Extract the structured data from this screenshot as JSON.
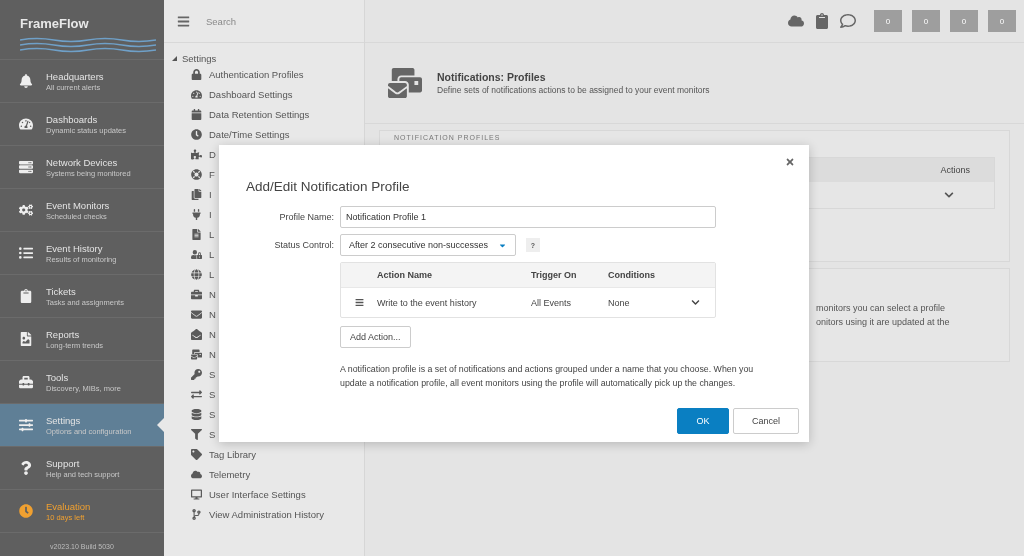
{
  "sidebar": {
    "brand": "FrameFlow",
    "nav": [
      {
        "title": "Headquarters",
        "subtitle": "All current alerts",
        "selected": false,
        "kind": "nav"
      },
      {
        "title": "Dashboards",
        "subtitle": "Dynamic status updates",
        "selected": false,
        "kind": "nav"
      },
      {
        "title": "Network Devices",
        "subtitle": "Systems being monitored",
        "selected": false,
        "kind": "nav"
      },
      {
        "title": "Event Monitors",
        "subtitle": "Scheduled checks",
        "selected": false,
        "kind": "nav"
      },
      {
        "title": "Event History",
        "subtitle": "Results of monitoring",
        "selected": false,
        "kind": "nav"
      },
      {
        "title": "Tickets",
        "subtitle": "Tasks and assignments",
        "selected": false,
        "kind": "nav"
      },
      {
        "title": "Reports",
        "subtitle": "Long-term trends",
        "selected": false,
        "kind": "nav"
      },
      {
        "title": "Tools",
        "subtitle": "Discovery, MIBs, more",
        "selected": false,
        "kind": "nav"
      },
      {
        "title": "Settings",
        "subtitle": "Options and configuration",
        "selected": true,
        "kind": "nav"
      },
      {
        "title": "Support",
        "subtitle": "Help and tech support",
        "selected": false,
        "kind": "nav"
      },
      {
        "title": "Evaluation",
        "subtitle": "10 days left",
        "selected": false,
        "kind": "warning"
      }
    ],
    "version": "v2023.10 Build 5030"
  },
  "settings_nav": {
    "search": {
      "placeholder": "Search"
    },
    "tree": {
      "label": "Settings",
      "expanded": true,
      "children": [
        {
          "label": "Authentication Profiles"
        },
        {
          "label": "Dashboard Settings"
        },
        {
          "label": "Data Retention Settings"
        },
        {
          "label": "Date/Time Settings"
        },
        {
          "label": "D"
        },
        {
          "label": "F"
        },
        {
          "label": "I"
        },
        {
          "label": "I"
        },
        {
          "label": "L"
        },
        {
          "label": "L"
        },
        {
          "label": "L"
        },
        {
          "label": "N"
        },
        {
          "label": "N"
        },
        {
          "label": "N"
        },
        {
          "label": "N"
        },
        {
          "label": "S"
        },
        {
          "label": "S"
        },
        {
          "label": "S"
        },
        {
          "label": "S"
        },
        {
          "label": "Tag Library"
        },
        {
          "label": "Telemetry"
        },
        {
          "label": "User Interface Settings"
        },
        {
          "label": "View Administration History"
        }
      ]
    }
  },
  "topbar": {
    "counters": [
      "0",
      "0",
      "0",
      "0"
    ]
  },
  "page_header": {
    "title": "Notifications: Profiles",
    "description": "Define sets of notifications actions to be assigned to your event monitors"
  },
  "profiles_card": {
    "label": "NOTIFICATION PROFILES",
    "columns": [
      "Actions"
    ]
  },
  "info_card": {
    "lines": [
      "monitors you can select a profile",
      "onitors using it are updated at the"
    ]
  },
  "modal": {
    "title": "Add/Edit Notification Profile",
    "profile_name": {
      "label": "Profile Name:",
      "value": "Notification Profile 1"
    },
    "status_control": {
      "label": "Status Control:",
      "value": "After 2 consecutive non-successes",
      "help": "?"
    },
    "actions_table": {
      "columns": [
        "Action Name",
        "Trigger On",
        "Conditions"
      ],
      "rows": [
        {
          "action_name": "Write to the event history",
          "trigger_on": "All Events",
          "conditions": "None"
        }
      ]
    },
    "add_button": "Add Action...",
    "description": "A notification profile is a set of notifications and actions grouped under a name that you choose. When you update a notification profile, all event monitors using the profile will automatically pick up the changes.",
    "ok": "OK",
    "cancel": "Cancel"
  }
}
